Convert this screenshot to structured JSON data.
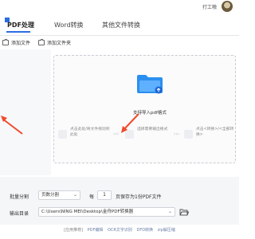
{
  "app": {
    "title": "PDF处理",
    "tabs": [
      {
        "label": "PDF处理"
      },
      {
        "label": "Word转换"
      },
      {
        "label": "其他文件转换"
      }
    ],
    "user_name": "打工嗷"
  },
  "toolbar": {
    "add_file": "添加文件",
    "add_folder": "添加文件夹"
  },
  "dropzone": {
    "hint": "支持导入pdf格式",
    "steps": [
      {
        "text": "点击此处/将文件拖动到此处"
      },
      {
        "text": "选择需要输出格式"
      },
      {
        "text": "点击<转换>/<全部转换>"
      }
    ]
  },
  "settings": {
    "batch_label": "批量分割",
    "batch_mode": "页数分割",
    "per_label": "每",
    "per_value": "1",
    "per_suffix": "页保存为1份PDF文件",
    "output_label": "输出目录",
    "output_path": "C:\\Users\\NING MEI\\Desktop\\金舟PDF转换器"
  },
  "footer": {
    "items": [
      "[应用推荐]",
      "PDF编辑",
      "OCR文字识别",
      "DFD转换",
      "zip解压缩"
    ]
  },
  "colors": {
    "accent": "#2b6de5",
    "arrow": "#f04a2c",
    "folder": "#2b8ff0"
  }
}
